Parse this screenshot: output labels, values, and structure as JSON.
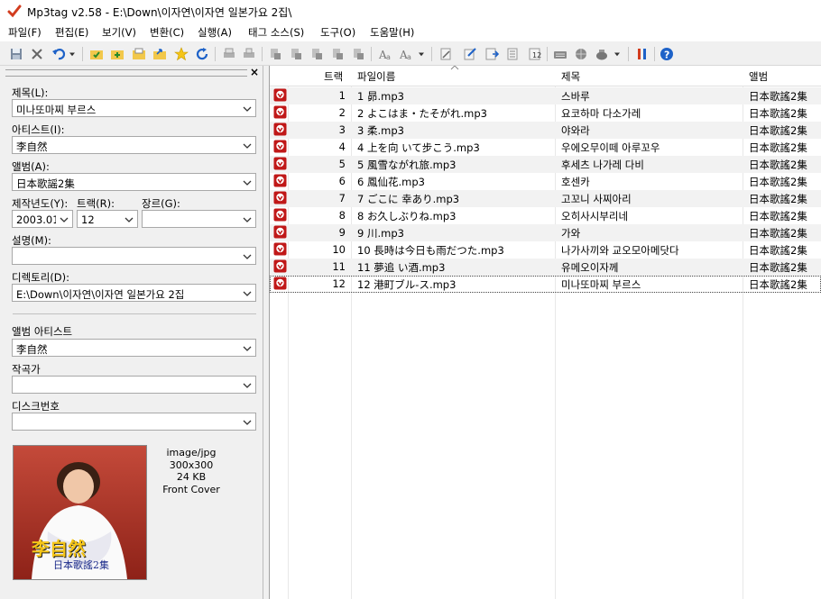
{
  "window": {
    "app": "Mp3tag v2.58",
    "separator": " - ",
    "path": "E:\\Down\\이자연\\이자연 일본가요 2집\\"
  },
  "menu": [
    "파일(F)",
    "편집(E)",
    "보기(V)",
    "변환(C)",
    "실행(A)",
    "태그 소스(S)",
    "도구(O)",
    "도움말(H)"
  ],
  "toolbar_icons": [
    "save-icon",
    "delete-icon",
    "undo-icon",
    "dropdown-icon",
    "folder-icon",
    "add-folder-icon",
    "open-folder-icon",
    "export-icon",
    "favorite-icon",
    "refresh-icon",
    "print-icon",
    "print-preview-icon",
    "filter-icon",
    "filter2-icon",
    "filter3-icon",
    "filter4-icon",
    "filter5-icon",
    "case-icon",
    "case2-icon",
    "case-dropdown-icon",
    "text-icon",
    "edit-icon",
    "edit2-icon",
    "edit3-icon",
    "number-icon",
    "keyboard-icon",
    "globe-icon",
    "pot-icon",
    "pot-dropdown-icon",
    "tools-icon",
    "help-icon"
  ],
  "panel": {
    "close_label": "×",
    "fields": {
      "title": {
        "label": "제목(L):",
        "value": "미나또마찌 부르스"
      },
      "artist": {
        "label": "아티스트(I):",
        "value": "李自然"
      },
      "album": {
        "label": "앨범(A):",
        "value": "日本歌謡2集"
      },
      "year": {
        "label": "제작년도(Y):",
        "value": "2003.01."
      },
      "track": {
        "label": "트랙(R):",
        "value": "12"
      },
      "genre": {
        "label": "장르(G):",
        "value": ""
      },
      "comment": {
        "label": "설명(M):",
        "value": ""
      },
      "directory": {
        "label": "디렉토리(D):",
        "value": "E:\\Down\\이자연\\이자연 일본가요 2집"
      },
      "album_artist": {
        "label": "앨범 아티스트",
        "value": "李自然"
      },
      "composer": {
        "label": "작곡가",
        "value": ""
      },
      "disc": {
        "label": "디스크번호",
        "value": ""
      }
    },
    "cover": {
      "type": "image/jpg",
      "size": "300x300",
      "filesize": "24 KB",
      "kind": "Front Cover",
      "text_main": "李自然",
      "text_sub": "日本歌謠2集"
    }
  },
  "grid": {
    "headers": {
      "track": "트랙",
      "filename": "파일이름",
      "title": "제목",
      "album": "앨범"
    },
    "rows": [
      {
        "track": "1",
        "filename": "1 昴.mp3",
        "title": "스바루",
        "album": "日本歌謠2集"
      },
      {
        "track": "2",
        "filename": "2 よこはま・たそがれ.mp3",
        "title": "요코하마 다소가레",
        "album": "日本歌謠2集"
      },
      {
        "track": "3",
        "filename": "3 柔.mp3",
        "title": "야와라",
        "album": "日本歌謠2集"
      },
      {
        "track": "4",
        "filename": "4 上を向 いて步こう.mp3",
        "title": "우에오무이떼 아루꼬우",
        "album": "日本歌謠2集"
      },
      {
        "track": "5",
        "filename": "5 風雪ながれ旅.mp3",
        "title": "후세츠 나가레 다비",
        "album": "日本歌謠2集"
      },
      {
        "track": "6",
        "filename": "6 鳳仙花.mp3",
        "title": "호센카",
        "album": "日本歌謠2集"
      },
      {
        "track": "7",
        "filename": "7 ごこに 幸あり.mp3",
        "title": "고꼬니 사찌아리",
        "album": "日本歌謠2集"
      },
      {
        "track": "8",
        "filename": "8 お久しぶりね.mp3",
        "title": "오히사시부리네",
        "album": "日本歌謠2集"
      },
      {
        "track": "9",
        "filename": "9 川.mp3",
        "title": "가와",
        "album": "日本歌謠2集"
      },
      {
        "track": "10",
        "filename": "10 長時は今日も雨だつた.mp3",
        "title": "나가사끼와 교오모아메닷다",
        "album": "日本歌謠2集"
      },
      {
        "track": "11",
        "filename": "11 夢追 い酒.mp3",
        "title": "유메오이자께",
        "album": "日本歌謠2集"
      },
      {
        "track": "12",
        "filename": "12 港町ブル-ス.mp3",
        "title": "미나또마찌 부르스",
        "album": "日本歌謠2集"
      }
    ]
  }
}
